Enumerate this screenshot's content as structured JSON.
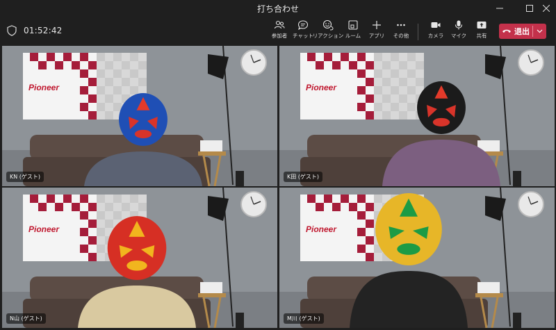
{
  "window": {
    "title": "打ち合わせ",
    "controls": [
      "minimize",
      "maximize",
      "close"
    ]
  },
  "meeting": {
    "elapsed": "01:52:42"
  },
  "toolbar": {
    "participants_label": "参加者",
    "chat_label": "チャット",
    "reactions_label": "リアクション",
    "rooms_label": "ルーム",
    "apps_label": "アプリ",
    "more_label": "その他",
    "camera_label": "カメラ",
    "mic_label": "マイク",
    "share_label": "共有",
    "leave_label": "退出",
    "leave_color": "#c4314b"
  },
  "participants": [
    {
      "name": "KN (ゲスト)",
      "mask": "blue-red"
    },
    {
      "name": "K田 (ゲスト)",
      "mask": "black-red"
    },
    {
      "name": "N山 (ゲスト)",
      "mask": "red-yellow"
    },
    {
      "name": "M川 (ゲスト)",
      "mask": "yellow-green"
    }
  ],
  "background": {
    "brand": "Pioneer"
  }
}
